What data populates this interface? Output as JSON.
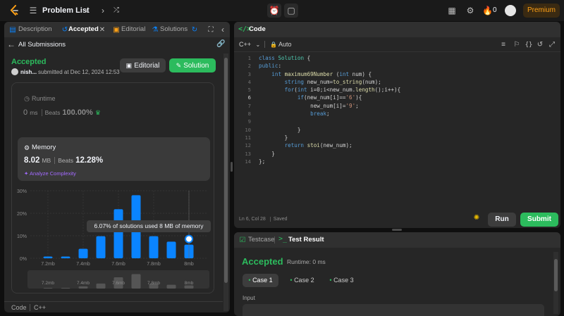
{
  "nav": {
    "title": "Problem List",
    "streak": "0",
    "premium": "Premium"
  },
  "left_tabs": {
    "description": "Description",
    "accepted": "Accepted",
    "editorial": "Editorial",
    "solutions": "Solutions"
  },
  "submission": {
    "back": "All Submissions",
    "status": "Accepted",
    "user": "nish...",
    "submitted": "submitted at Dec 12, 2024 12:53",
    "editorial_btn": "Editorial",
    "solution_btn": "Solution"
  },
  "runtime": {
    "label": "Runtime",
    "value": "0",
    "unit": "ms",
    "beats_label": "Beats",
    "beats": "100.00%"
  },
  "memory": {
    "label": "Memory",
    "value": "8.02",
    "unit": "MB",
    "beats_label": "Beats",
    "beats": "12.28%",
    "analyze": "Analyze Complexity"
  },
  "tooltip": "6.07% of solutions used 8 MB of memory",
  "chart_data": {
    "type": "bar",
    "y_ticks": [
      "30%",
      "20%",
      "10%",
      "0%"
    ],
    "ylim": [
      0,
      30
    ],
    "x_ticks": [
      "7.2mb",
      "7.4mb",
      "7.6mb",
      "7.8mb",
      "8mb"
    ],
    "x": [
      7.2,
      7.3,
      7.4,
      7.5,
      7.6,
      7.7,
      7.8,
      7.9,
      8.0
    ],
    "values": [
      0.8,
      0.8,
      4.2,
      9.8,
      21.8,
      28.0,
      9.8,
      7.4,
      6.07
    ],
    "highlight_index": 8,
    "grid": true
  },
  "left_footer": {
    "code_label": "Code",
    "lang": "C++"
  },
  "code_panel": {
    "title": "Code",
    "lang": "C++",
    "auto": "Auto",
    "lines": [
      "class Solution {",
      "public:",
      "    int maximum69Number (int num) {",
      "        string new_num=to_string(num);",
      "        for(int i=0;i<new_num.length();i++){",
      "            if(new_num[i]=='6'){",
      "                new_num[i]='9';",
      "                break;",
      "",
      "            }",
      "        }",
      "        return stoi(new_num);",
      "    }",
      "};"
    ],
    "status": "Ln 6, Col 28",
    "saved": "Saved",
    "run": "Run",
    "submit": "Submit"
  },
  "result_panel": {
    "testcase_tab": "Testcase",
    "result_tab": "Test Result",
    "status": "Accepted",
    "runtime": "Runtime: 0 ms",
    "cases": [
      "Case 1",
      "Case 2",
      "Case 3"
    ],
    "input_label": "Input"
  },
  "colors": {
    "accent_green": "#2cbb5d",
    "bar_blue": "#0a84ff",
    "premium": "#ffa116"
  }
}
